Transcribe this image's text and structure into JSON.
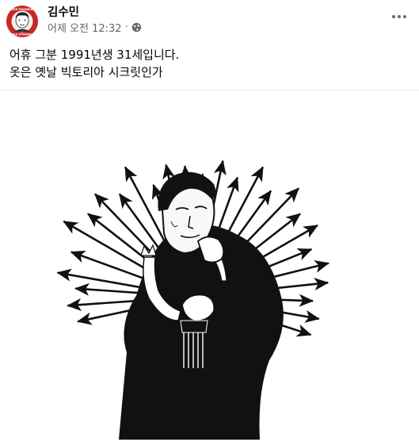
{
  "post": {
    "author": "김수민",
    "timestamp": "어제 오전 12:32",
    "separator": "·",
    "privacy_icon": "globe-icon",
    "more_icon": "more-horizontal-icon",
    "text_lines": [
      "어휴 그분 1991년생 31세입니다.",
      "옷은 옛날 빅토리아 시크릿인가"
    ]
  },
  "avatar": {
    "badge_text_top": "FREE MYANMAR",
    "badge_text_bottom": "FREE MYANMAR"
  },
  "colors": {
    "text": "#050505",
    "secondary_text": "#65676b",
    "avatar_ring": "#c62828",
    "divider": "#e4e6eb"
  }
}
